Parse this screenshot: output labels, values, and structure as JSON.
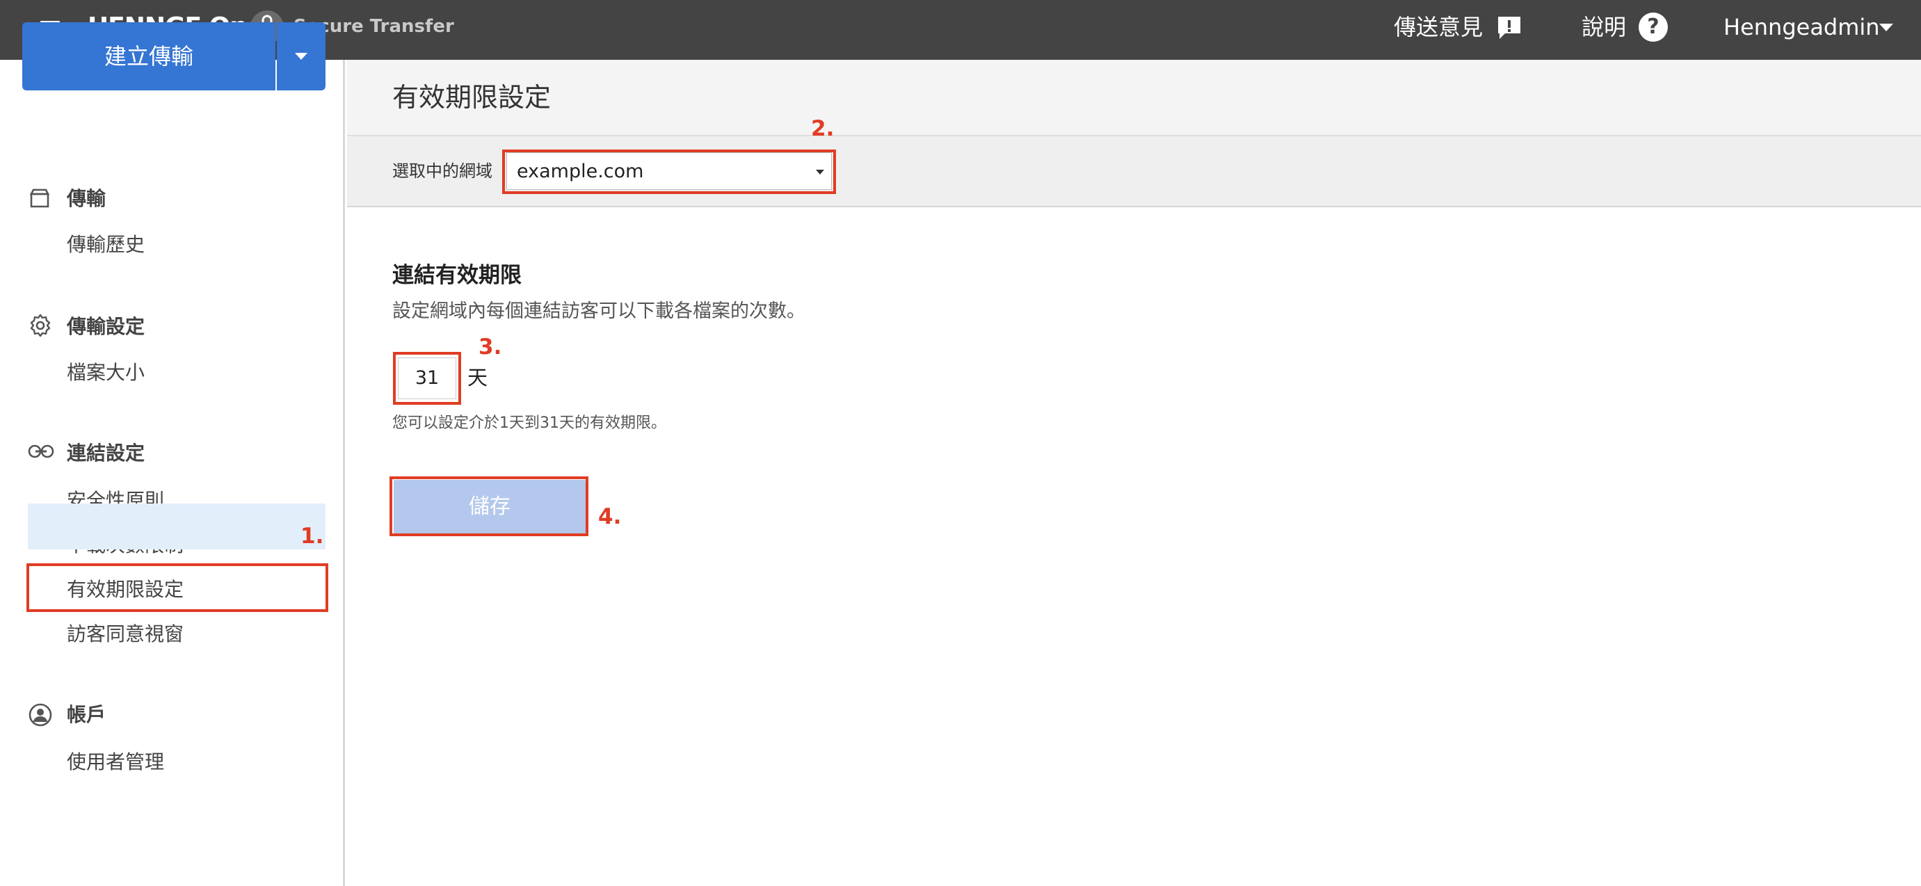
{
  "topbar": {
    "brand": "HENNGE One",
    "product": "Secure Transfer",
    "feedback_label": "傳送意見",
    "help_label": "說明",
    "help_icon_glyph": "?",
    "user_label": "Henngeadmin"
  },
  "sidebar": {
    "create_button": "建立傳輸",
    "sections": [
      {
        "title": "傳輸",
        "icon": "box-icon",
        "items": [
          "傳輸歷史"
        ]
      },
      {
        "title": "傳輸設定",
        "icon": "gear-icon",
        "items": [
          "檔案大小"
        ]
      },
      {
        "title": "連結設定",
        "icon": "link-icon",
        "items": [
          "安全性原則",
          "下載次數限制",
          "有效期限設定",
          "訪客同意視窗"
        ],
        "active_item": "有效期限設定"
      },
      {
        "title": "帳戶",
        "icon": "user-circle-icon",
        "items": [
          "使用者管理"
        ]
      }
    ]
  },
  "main": {
    "page_title": "有效期限設定",
    "domain_label": "選取中的網域",
    "domain_value": "example.com",
    "section_heading": "連結有效期限",
    "section_desc": "設定網域內每個連結訪客可以下載各檔案的次數。",
    "days_value": "31",
    "days_unit": "天",
    "days_hint": "您可以設定介於1天到31天的有效期限。",
    "save_label": "儲存"
  },
  "annotations": {
    "n1": "1.",
    "n2": "2.",
    "n3": "3.",
    "n4": "4."
  },
  "colors": {
    "topbar": "#444444",
    "primary": "#3575d3",
    "save_disabled": "#b3c8ec",
    "annotation": "#e03c24",
    "active_nav_bg": "#e3eefb"
  }
}
